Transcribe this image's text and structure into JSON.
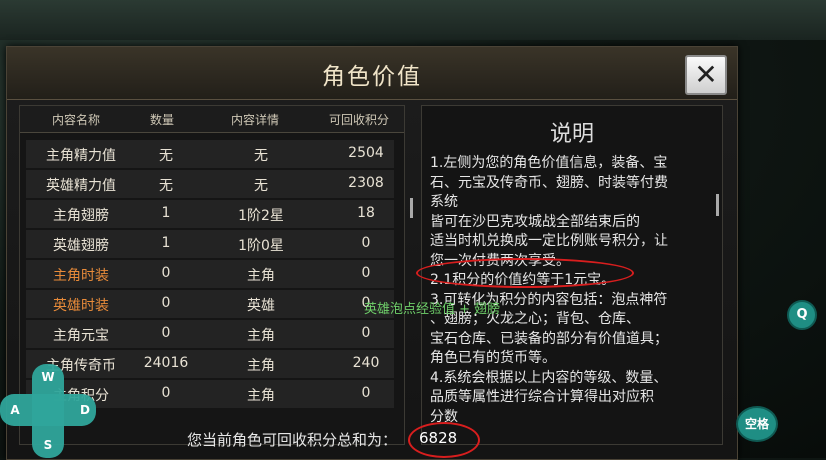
{
  "window": {
    "title": "角色价值",
    "close_label": "✕"
  },
  "table": {
    "headers": [
      "内容名称",
      "数量",
      "内容详情",
      "可回收积分"
    ],
    "rows": [
      {
        "name": "主角精力值",
        "qty": "无",
        "detail": "无",
        "points": "2504",
        "highlight": false
      },
      {
        "name": "英雄精力值",
        "qty": "无",
        "detail": "无",
        "points": "2308",
        "highlight": false
      },
      {
        "name": "主角翅膀",
        "qty": "1",
        "detail": "1阶2星",
        "points": "18",
        "highlight": false
      },
      {
        "name": "英雄翅膀",
        "qty": "1",
        "detail": "1阶0星",
        "points": "0",
        "highlight": false
      },
      {
        "name": "主角时装",
        "qty": "0",
        "detail": "主角",
        "points": "0",
        "highlight": true
      },
      {
        "name": "英雄时装",
        "qty": "0",
        "detail": "英雄",
        "points": "0",
        "highlight": true
      },
      {
        "name": "主角元宝",
        "qty": "0",
        "detail": "主角",
        "points": "0",
        "highlight": false
      },
      {
        "name": "主角传奇币",
        "qty": "24016",
        "detail": "主角",
        "points": "240",
        "highlight": false
      },
      {
        "name": "主角积分",
        "qty": "0",
        "detail": "主角",
        "points": "0",
        "highlight": false
      }
    ]
  },
  "description": {
    "title": "说明",
    "lines": [
      "1.左侧为您的角色价值信息，装备、宝",
      "   石、元宝及传奇币、翅膀、时装等付费",
      "   系统",
      "   皆可在沙巴克攻城战全部结束后的",
      "   适当时机兑换成一定比例账号积分，让",
      "   您一次付费两次享受。",
      "2.1积分的价值约等于1元宝。",
      "3.可转化为积分的内容包括：泡点神符",
      "   、翅膀；火龙之心；背包、仓库、",
      "   宝石仓库、已装备的部分有价值道具；",
      "   角色已有的货币等。",
      "4.系统会根据以上内容的等级、数量、",
      "   品质等属性进行综合计算得出对应积",
      "   分数"
    ]
  },
  "footer": {
    "label": "您当前角色可回收积分总和为：",
    "total": "6828"
  },
  "floating_text": "英雄泡点经验值 + 翅膀",
  "controls": {
    "up": "W",
    "left": "A",
    "right": "D",
    "down": "S",
    "q_button": "Q",
    "space_button": "空格"
  },
  "colors": {
    "highlight": "#e88b3a",
    "circle": "#d81e1e",
    "button": "#1f8e84"
  }
}
